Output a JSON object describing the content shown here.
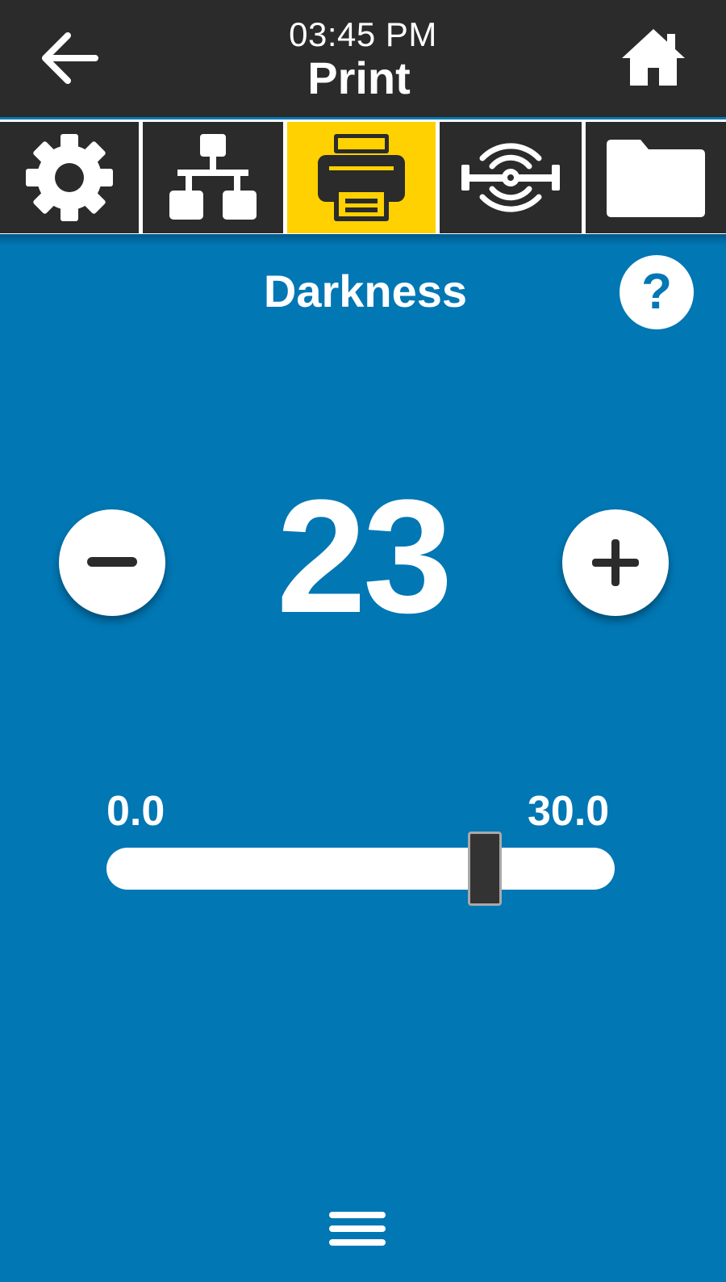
{
  "header": {
    "time": "03:45 PM",
    "title": "Print"
  },
  "tabs": [
    {
      "icon": "gear-icon",
      "name": "settings"
    },
    {
      "icon": "network-icon",
      "name": "network"
    },
    {
      "icon": "printer-icon",
      "name": "print",
      "active": true
    },
    {
      "icon": "sensor-icon",
      "name": "sensor"
    },
    {
      "icon": "folder-icon",
      "name": "storage"
    }
  ],
  "setting": {
    "heading": "Darkness",
    "value": "23",
    "min_label": "0.0",
    "max_label": "30.0",
    "min": 0.0,
    "max": 30.0,
    "current": 23
  },
  "colors": {
    "background": "#0177b4",
    "bar": "#2b2b2b",
    "active_tab": "#ffd100"
  }
}
